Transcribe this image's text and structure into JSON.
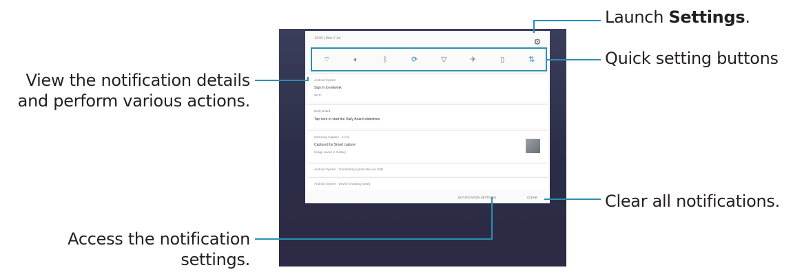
{
  "callouts": {
    "launch_prefix": "Launch ",
    "launch_bold": "Settings",
    "launch_suffix": ".",
    "quick": "Quick setting buttons",
    "view_line1": "View the notification details",
    "view_line2": "and perform various actions.",
    "clear": "Clear all notifications.",
    "access_line1": "Access the notification",
    "access_line2": "settings."
  },
  "colors": {
    "callout_line": "#2a8fb3",
    "quick_highlight": "#2a8fb3",
    "quick_icon_active": "#2a8fb3",
    "quick_icon_inactive": "#7a7a7a"
  },
  "status_bar": {
    "time": "14:00 | Mon 2 Jul"
  },
  "quick_buttons": [
    {
      "name": "wifi-icon",
      "glyph": "⌔",
      "active": true
    },
    {
      "name": "sound-icon",
      "glyph": "🔈︎",
      "active": false
    },
    {
      "name": "bluetooth-icon",
      "glyph": "ᛒ",
      "active": false
    },
    {
      "name": "auto-rotate-icon",
      "glyph": "⟳",
      "active": true
    },
    {
      "name": "flashlight-icon",
      "glyph": "▽",
      "active": false
    },
    {
      "name": "airplane-mode-icon",
      "glyph": "✈︎",
      "active": false
    },
    {
      "name": "power-saving-icon",
      "glyph": "▯",
      "active": false
    },
    {
      "name": "mobile-data-icon",
      "glyph": "⇅",
      "active": true
    }
  ],
  "notifications": [
    {
      "app": "Android System",
      "title": "Sign in to network",
      "sub": "Wi-Fi"
    },
    {
      "app": "Daily Board",
      "title": "Tap here to start the Daily Board slideshow.",
      "sub": ""
    },
    {
      "app": "Samsung Capture · 1 min",
      "title": "Captured by Smart capture",
      "sub": "Image saved in Gallery."
    },
    {
      "app": "Android System · Transferring media files via USB",
      "title": "",
      "sub": ""
    },
    {
      "app": "Android System · Device charging slowly",
      "title": "",
      "sub": ""
    }
  ],
  "actions": {
    "notification_settings": "NOTIFICATION SETTINGS",
    "clear": "CLEAR"
  }
}
